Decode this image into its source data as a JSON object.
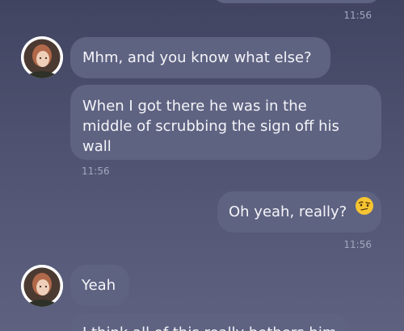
{
  "messages": [
    {
      "id": "m0",
      "direction": "outgoing",
      "time": "11:56"
    },
    {
      "id": "m1",
      "direction": "incoming",
      "text": "Mhm, and you know what else?"
    },
    {
      "id": "m2",
      "direction": "incoming",
      "lines": [
        "When I got there he was in the",
        "middle of scrubbing the sign off his",
        "wall"
      ],
      "time": "11:56"
    },
    {
      "id": "m3",
      "direction": "outgoing",
      "text": "Oh yeah, really?",
      "emoji": "raised-eyebrow-emoji",
      "time": "11:56"
    },
    {
      "id": "m4",
      "direction": "incoming",
      "text": "Yeah"
    },
    {
      "id": "m5",
      "direction": "incoming",
      "text": "I think all of this really bothers him"
    }
  ],
  "colors": {
    "background_top": "#414461",
    "background_bottom": "#5e6280",
    "bubble": "#5f6382",
    "timestamp": "#a3a6bd"
  }
}
